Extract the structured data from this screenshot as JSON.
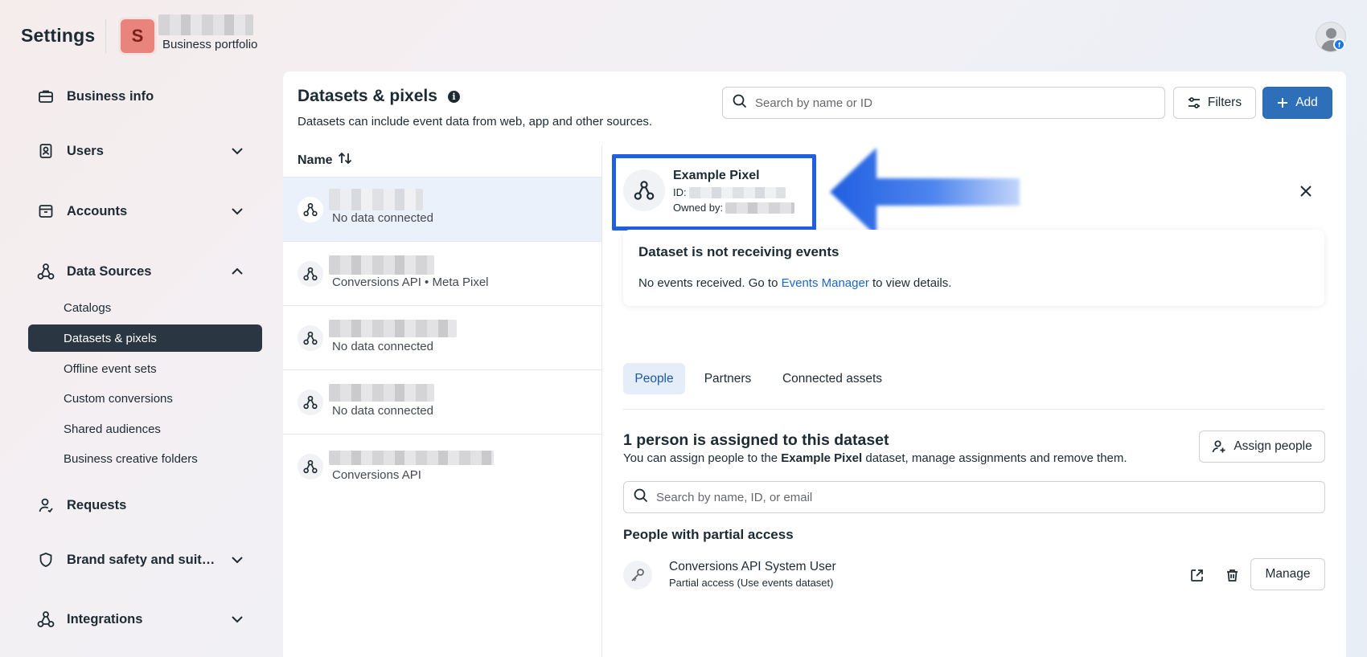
{
  "header": {
    "app_title": "Settings",
    "portfolio_initial": "S",
    "portfolio_label": "Business portfolio"
  },
  "sidebar": {
    "items": [
      {
        "label": "Business info",
        "icon": "briefcase-icon"
      },
      {
        "label": "Users",
        "icon": "user-badge-icon"
      },
      {
        "label": "Accounts",
        "icon": "archive-box-icon"
      },
      {
        "label": "Data Sources",
        "icon": "data-sources-icon"
      },
      {
        "label": "Requests",
        "icon": "person-request-icon"
      },
      {
        "label": "Brand safety and suit…",
        "icon": "shield-icon"
      },
      {
        "label": "Integrations",
        "icon": "integrations-icon"
      }
    ],
    "data_sources_children": [
      "Catalogs",
      "Datasets & pixels",
      "Offline event sets",
      "Custom conversions",
      "Shared audiences",
      "Business creative folders"
    ],
    "active_child": "Datasets & pixels"
  },
  "main": {
    "title": "Datasets & pixels",
    "subtitle": "Datasets can include event data from web, app and other sources.",
    "search_placeholder": "Search by name or ID",
    "filters_label": "Filters",
    "add_label": "Add",
    "list_header": "Name",
    "list_items": [
      {
        "status": "No data connected"
      },
      {
        "status": "Conversions API • Meta Pixel"
      },
      {
        "status": "No data connected"
      },
      {
        "status": "No data connected"
      },
      {
        "status": "Conversions API"
      }
    ]
  },
  "detail": {
    "name": "Example Pixel",
    "id_label": "ID:",
    "owned_label": "Owned by:",
    "alert": {
      "title": "Dataset is not receiving events",
      "text_before": "No events received. Go to ",
      "link": "Events Manager",
      "text_after": " to view details."
    },
    "tabs": [
      "People",
      "Partners",
      "Connected assets"
    ],
    "active_tab": "People",
    "people": {
      "title": "1 person is assigned to this dataset",
      "desc_before": "You can assign people to the ",
      "desc_bold": "Example Pixel",
      "desc_after": " dataset, manage assignments and remove them.",
      "assign_label": "Assign people",
      "search_placeholder": "Search by name, ID, or email",
      "partial_title": "People with partial access",
      "user": {
        "name": "Conversions API System User",
        "access": "Partial access (Use events dataset)"
      },
      "manage_label": "Manage"
    }
  },
  "colors": {
    "accent": "#2d6fb8",
    "sidebar_active": "#2a3641",
    "highlight_box": "#1f5fe0",
    "arrow": "#1f5fe0",
    "link": "#1b66c9"
  }
}
